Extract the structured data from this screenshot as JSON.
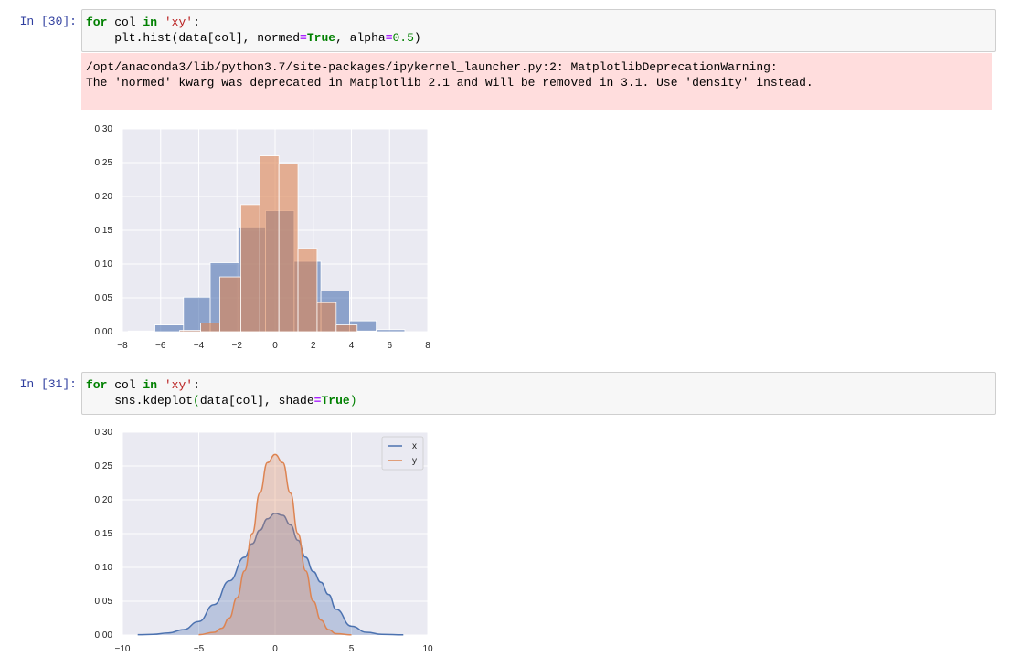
{
  "cells": [
    {
      "prompt": "In [30]:",
      "code": {
        "line1": {
          "kw_for": "for",
          "var": " col ",
          "kw_in": "in",
          "space": " ",
          "str": "'xy'",
          "colon": ":"
        },
        "line2": {
          "indent": "    plt.hist(data[col], normed",
          "eq1": "=",
          "true": "True",
          "mid": ", alpha",
          "eq2": "=",
          "num": "0.5",
          "close": ")"
        }
      },
      "stderr": [
        "/opt/anaconda3/lib/python3.7/site-packages/ipykernel_launcher.py:2: MatplotlibDeprecationWarning:",
        "The 'normed' kwarg was deprecated in Matplotlib 2.1 and will be removed in 3.1. Use 'density' instead."
      ]
    },
    {
      "prompt": "In [31]:",
      "code": {
        "line1": {
          "kw_for": "for",
          "var": " col ",
          "kw_in": "in",
          "space": " ",
          "str": "'xy'",
          "colon": ":"
        },
        "line2": {
          "indent": "    sns.kdeplot",
          "open": "(",
          "args": "data[col], shade",
          "eq1": "=",
          "true": "True",
          "close": ")"
        }
      }
    }
  ],
  "chart_data": [
    {
      "type": "bar",
      "subtype": "overlaid-histogram",
      "xlim": [
        -8,
        8
      ],
      "ylim": [
        0,
        0.3
      ],
      "xticks": [
        "−8",
        "−6",
        "−4",
        "−2",
        "0",
        "2",
        "4",
        "6",
        "8"
      ],
      "yticks": [
        "0.00",
        "0.05",
        "0.10",
        "0.15",
        "0.20",
        "0.25",
        "0.30"
      ],
      "grid": true,
      "series": [
        {
          "color": "#4c72b0",
          "alpha": 0.6,
          "bins": [
            [
              -7.7,
              -6.3,
              0.001
            ],
            [
              -6.3,
              -4.8,
              0.01
            ],
            [
              -4.8,
              -3.4,
              0.051
            ],
            [
              -3.4,
              -1.9,
              0.102
            ],
            [
              -1.9,
              -0.5,
              0.155
            ],
            [
              -0.5,
              1.0,
              0.179
            ],
            [
              1.0,
              2.4,
              0.104
            ],
            [
              2.4,
              3.9,
              0.06
            ],
            [
              3.9,
              5.3,
              0.016
            ],
            [
              5.3,
              6.8,
              0.003
            ]
          ]
        },
        {
          "color": "#dd8452",
          "alpha": 0.6,
          "bins": [
            [
              -5.0,
              -3.9,
              0.002
            ],
            [
              -3.9,
              -2.9,
              0.013
            ],
            [
              -2.9,
              -1.8,
              0.081
            ],
            [
              -1.8,
              -0.8,
              0.188
            ],
            [
              -0.8,
              0.2,
              0.26
            ],
            [
              0.2,
              1.2,
              0.248
            ],
            [
              1.2,
              2.2,
              0.123
            ],
            [
              2.2,
              3.2,
              0.043
            ],
            [
              3.2,
              4.3,
              0.01
            ],
            [
              4.3,
              5.3,
              0.001
            ]
          ]
        }
      ]
    },
    {
      "type": "area",
      "subtype": "kde",
      "xlim": [
        -10,
        10
      ],
      "ylim": [
        0,
        0.3
      ],
      "xticks": [
        "−10",
        "−5",
        "0",
        "5",
        "10"
      ],
      "yticks": [
        "0.00",
        "0.05",
        "0.10",
        "0.15",
        "0.20",
        "0.25",
        "0.30"
      ],
      "grid": true,
      "legend": "top-right",
      "series": [
        {
          "name": "x",
          "color": "#4c72b0",
          "x": [
            -9,
            -8,
            -7,
            -6,
            -5,
            -4,
            -3,
            -2,
            -1.5,
            -1,
            -0.5,
            0,
            0.5,
            1,
            1.5,
            2,
            2.5,
            3,
            3.5,
            4,
            5,
            6,
            7,
            8.4
          ],
          "y": [
            0.0005,
            0.001,
            0.003,
            0.008,
            0.02,
            0.045,
            0.08,
            0.115,
            0.135,
            0.155,
            0.172,
            0.18,
            0.177,
            0.163,
            0.14,
            0.115,
            0.094,
            0.078,
            0.06,
            0.038,
            0.013,
            0.004,
            0.001,
            0.0003
          ]
        },
        {
          "name": "y",
          "color": "#dd8452",
          "x": [
            -5,
            -4,
            -3.5,
            -3,
            -2.5,
            -2,
            -1.5,
            -1,
            -0.5,
            0,
            0.5,
            1,
            1.5,
            2,
            2.5,
            3,
            3.5,
            4,
            5
          ],
          "y": [
            0.0005,
            0.004,
            0.01,
            0.025,
            0.055,
            0.095,
            0.15,
            0.21,
            0.255,
            0.267,
            0.255,
            0.21,
            0.15,
            0.095,
            0.05,
            0.022,
            0.008,
            0.002,
            0.0003
          ]
        }
      ]
    }
  ]
}
